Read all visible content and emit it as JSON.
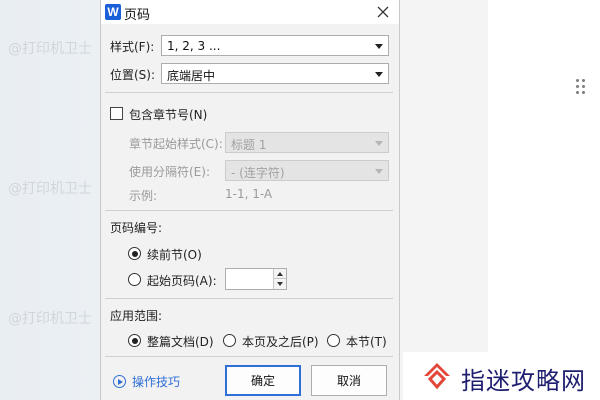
{
  "watermark": "@打印机卫士",
  "dialog": {
    "title": "页码",
    "app_icon_letter": "W",
    "style_label": "样式(F):",
    "style_value": "1, 2, 3 ...",
    "position_label": "位置(S):",
    "position_value": "底端居中",
    "include_chapter_label": "包含章节号(N)",
    "chapter_start_style_label": "章节起始样式(C):",
    "chapter_start_style_value": "标题 1",
    "separator_label": "使用分隔符(E):",
    "separator_value": "-  (连字符)",
    "example_label": "示例:",
    "example_value": "1-1, 1-A",
    "numbering_section_label": "页码编号:",
    "continue_label": "续前节(O)",
    "start_at_label": "起始页码(A):",
    "start_at_value": "",
    "apply_section_label": "应用范围:",
    "apply_options": [
      "整篇文档(D)",
      "本页及之后(P)",
      "本节(T)"
    ],
    "tips_label": "操作技巧",
    "ok_label": "确定",
    "cancel_label": "取消"
  },
  "brand": {
    "name": "指迷攻略网"
  },
  "colors": {
    "accent": "#2f6fd6",
    "word_icon": "#1b5fd9",
    "brand_text": "#1e1e70",
    "brand_logo": "#e2473a"
  }
}
